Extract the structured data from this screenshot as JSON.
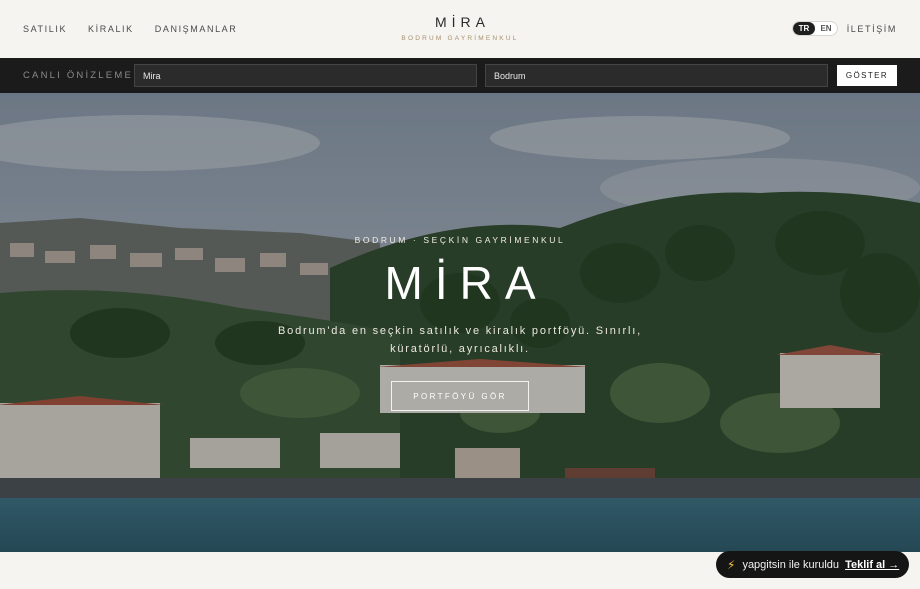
{
  "nav": {
    "left_links": [
      "SATILIK",
      "KİRALIK",
      "DANIŞMANLAR"
    ],
    "brand_name": "MİRA",
    "brand_sub": "BODRUM GAYRİMENKUL",
    "lang_active": "TR",
    "lang_inactive": "EN",
    "contact": "İLETİŞİM"
  },
  "preview": {
    "label": "CANLI ÖNİZLEME",
    "name_value": "Mira",
    "city_value": "Bodrum",
    "button": "GÖSTER"
  },
  "hero": {
    "kicker": "BODRUM · SEÇKİN GAYRİMENKUL",
    "title": "MİRA",
    "description": "Bodrum'da en seçkin satılık ve kiralık portföyü. Sınırlı, küratörlü, ayrıcalıklı.",
    "button": "PORTFÖYÜ GÖR"
  },
  "badge": {
    "icon": "lightning-icon",
    "text": "yapgitsin ile kuruldu",
    "link": "Teklif al →"
  },
  "colors": {
    "accent_gold": "#a7906c",
    "dark": "#1b1b1b",
    "background": "#f5f4f1"
  }
}
